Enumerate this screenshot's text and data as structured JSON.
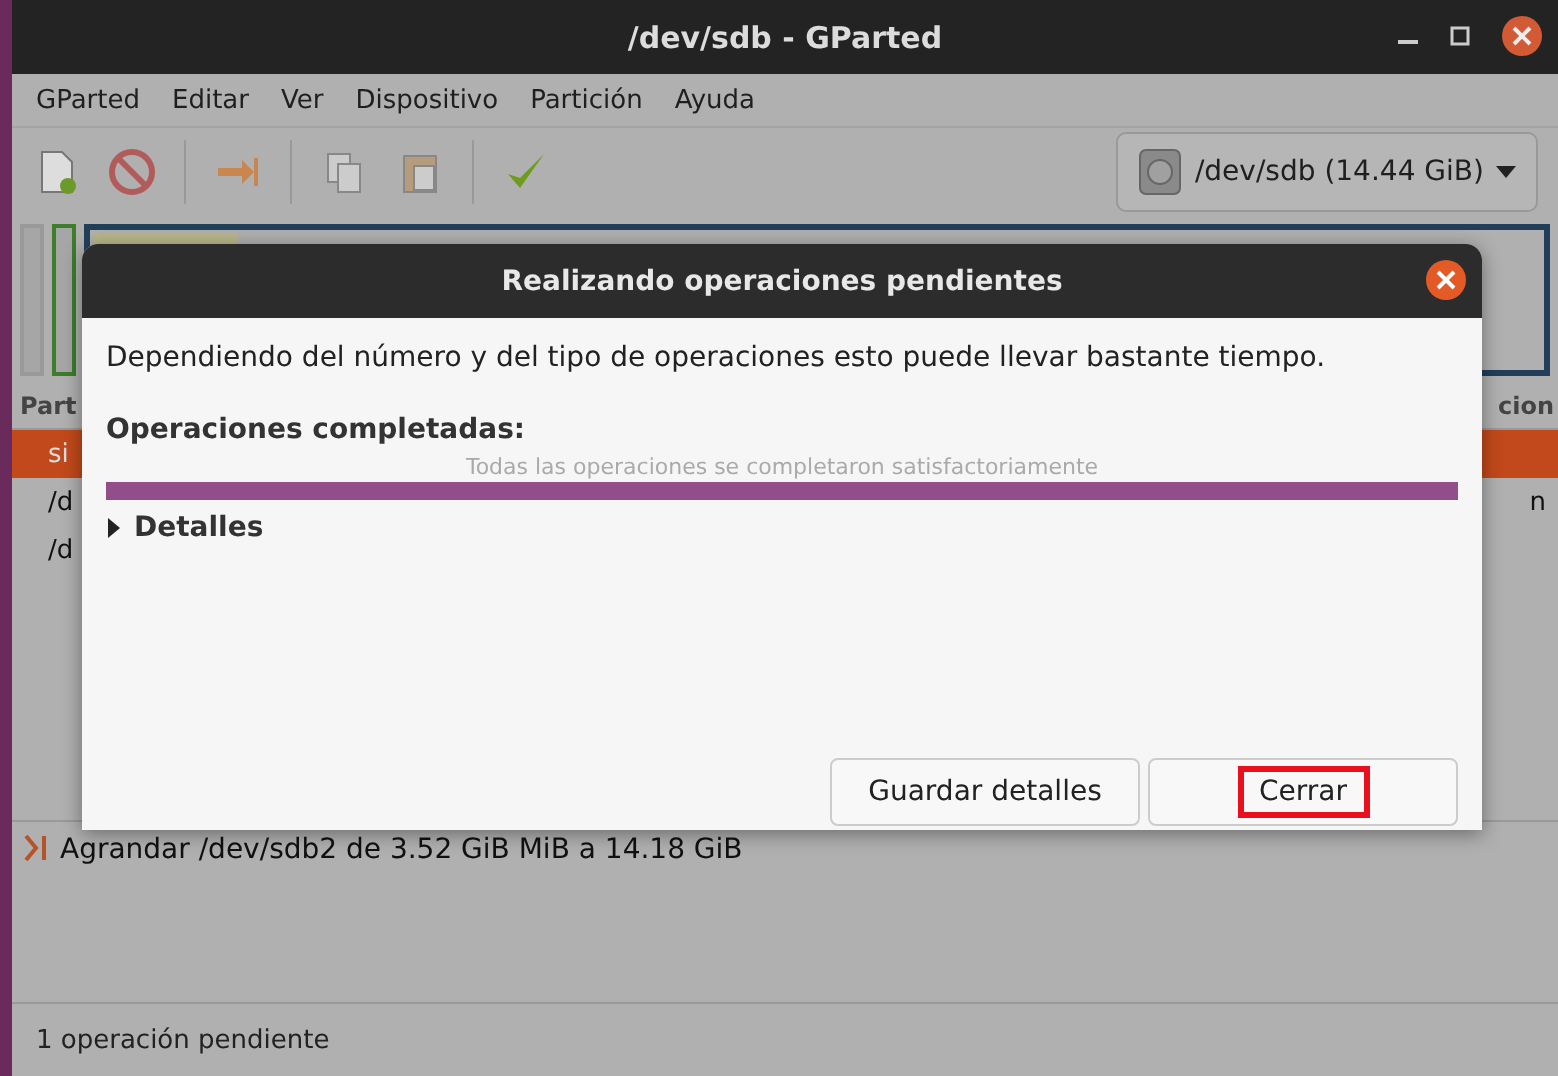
{
  "window": {
    "title": "/dev/sdb - GParted"
  },
  "menu": [
    "GParted",
    "Editar",
    "Ver",
    "Dispositivo",
    "Partición",
    "Ayuda"
  ],
  "toolbar": {
    "device": "/dev/sdb (14.44 GiB)"
  },
  "disk_map": {
    "level": 0.1
  },
  "partition_table": {
    "columns": [
      "Part",
      "cion"
    ],
    "rows": [
      {
        "column_1": "si",
        "selected": true
      },
      {
        "column_1": "/d",
        "column_2": "n",
        "selected": false
      },
      {
        "column_1": "/d",
        "selected": false
      }
    ]
  },
  "operations": [
    "Agrandar /dev/sdb2 de 3.52 GiB MiB a 14.18 GiB"
  ],
  "status_bar": "1 operación pendiente",
  "dialog": {
    "title": "Realizando operaciones pendientes",
    "message": "Dependiendo del número y del tipo de operaciones esto puede llevar bastante tiempo.",
    "heading": "Operaciones completadas:",
    "progress": {
      "text": "Todas las operaciones se completaron satisfactoriamente",
      "level": 1
    },
    "details": {
      "label": "Detalles",
      "expanded": false
    },
    "buttons": [
      {
        "label": "Guardar detalles",
        "highlighted": false
      },
      {
        "label": "Cerrar",
        "highlighted": true
      }
    ]
  }
}
